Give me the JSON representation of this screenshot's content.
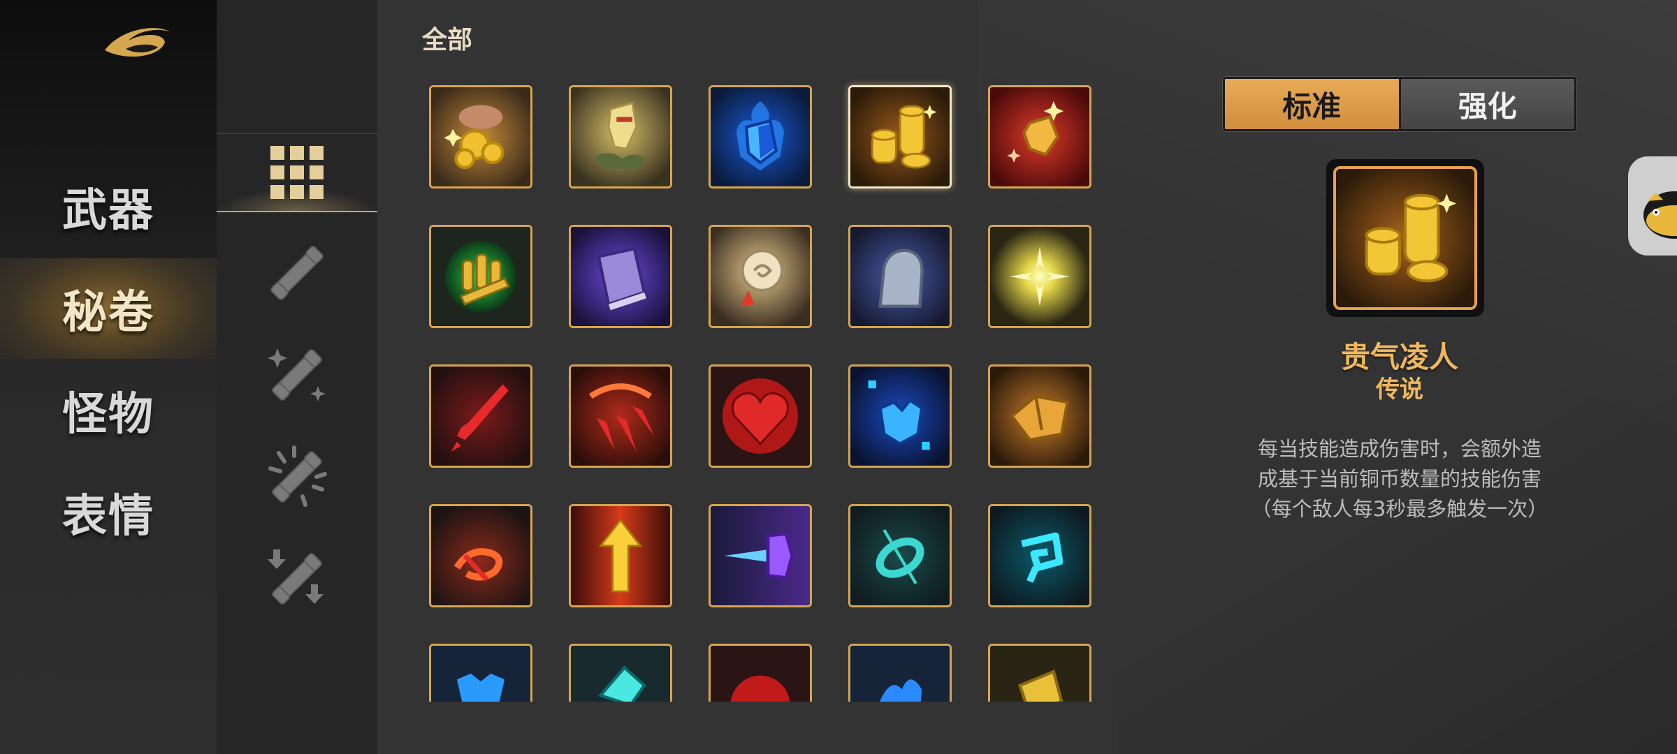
{
  "main_nav": {
    "items": [
      {
        "label": "武器",
        "active": false
      },
      {
        "label": "秘卷",
        "active": true
      },
      {
        "label": "怪物",
        "active": false
      },
      {
        "label": "表情",
        "active": false
      }
    ]
  },
  "sub_nav": {
    "items": [
      {
        "icon": "grid-icon",
        "active": true
      },
      {
        "icon": "weapon-basic-icon",
        "active": false
      },
      {
        "icon": "weapon-sparkle-icon",
        "active": false
      },
      {
        "icon": "weapon-burst-icon",
        "active": false
      },
      {
        "icon": "weapon-arrows-icon",
        "active": false
      }
    ]
  },
  "grid": {
    "title": "全部",
    "selected_index": 3,
    "tiles": [
      {
        "icon": "gold-coins-hand-icon"
      },
      {
        "icon": "golden-gauntlet-icon"
      },
      {
        "icon": "blue-shield-flame-icon"
      },
      {
        "icon": "gold-coin-stack-icon"
      },
      {
        "icon": "red-crystal-icon"
      },
      {
        "icon": "green-bullets-icon"
      },
      {
        "icon": "purple-book-icon"
      },
      {
        "icon": "scroll-rune-icon"
      },
      {
        "icon": "stone-hand-icon"
      },
      {
        "icon": "light-burst-icon"
      },
      {
        "icon": "red-dagger-icon"
      },
      {
        "icon": "red-claws-slash-icon"
      },
      {
        "icon": "red-heart-icon"
      },
      {
        "icon": "blue-gem-icon"
      },
      {
        "icon": "gold-bag-icon"
      },
      {
        "icon": "fire-swirl-icon"
      },
      {
        "icon": "golden-arrow-up-icon"
      },
      {
        "icon": "purple-rod-icon"
      },
      {
        "icon": "teal-ring-icon"
      },
      {
        "icon": "cyan-spiral-icon"
      },
      {
        "icon": "blue-mask-icon"
      },
      {
        "icon": "teal-claw-icon"
      },
      {
        "icon": "red-orb-icon"
      },
      {
        "icon": "blue-splash-icon"
      },
      {
        "icon": "gold-rune-icon"
      }
    ]
  },
  "detail": {
    "mode_tabs": [
      {
        "label": "标准",
        "active": true
      },
      {
        "label": "强化",
        "active": false
      }
    ],
    "icon": "gold-coin-stack-icon",
    "name": "贵气凌人",
    "rarity": "传说",
    "description_lines": [
      "每当技能造成伤害时，会额外造",
      "成基于当前铜币数量的技能伤害",
      "（每个敌人每3秒最多触发一次）"
    ]
  },
  "colors": {
    "accent_gold": "#d6a550",
    "active_tab": "#e9aa56",
    "legend_text": "#f0b85e",
    "background": "#333334"
  }
}
